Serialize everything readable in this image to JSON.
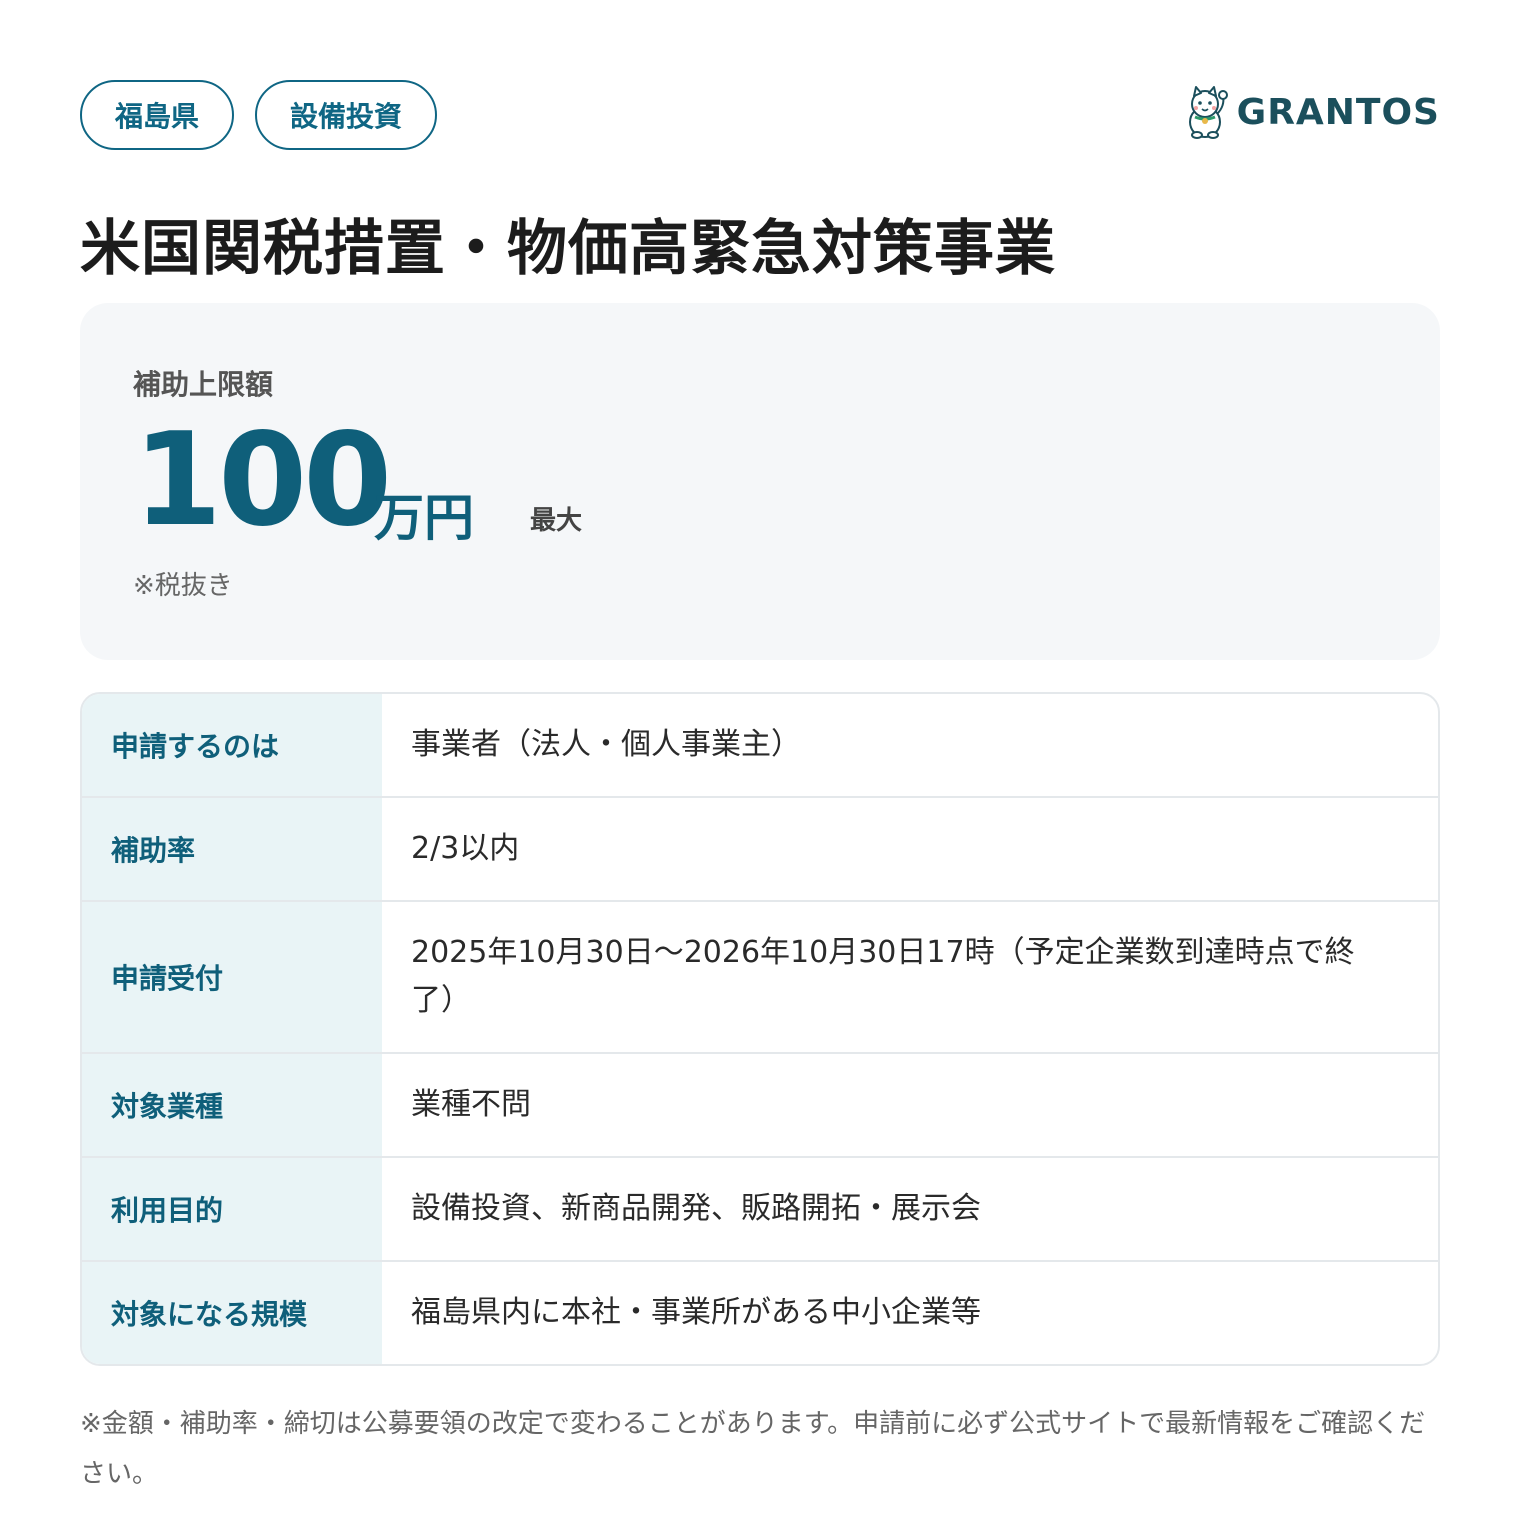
{
  "tags": [
    "福島県",
    "設備投資"
  ],
  "brand": {
    "name": "GRANTOS",
    "logo_icon": "lucky-cat-icon",
    "color": "#1b4f5c"
  },
  "title": "米国関税措置・物価高緊急対策事業",
  "amount": {
    "label": "補助上限額",
    "value": "100",
    "unit": "万円",
    "qualifier": "最大",
    "note": "※税抜き"
  },
  "details": [
    {
      "label": "申請するのは",
      "value": "事業者（法人・個人事業主）"
    },
    {
      "label": "補助率",
      "value": "2/3以内"
    },
    {
      "label": "申請受付",
      "value": "2025年10月30日〜2026年10月30日17時（予定企業数到達時点で終了）"
    },
    {
      "label": "対象業種",
      "value": "業種不問"
    },
    {
      "label": "利用目的",
      "value": "設備投資、新商品開発、販路開拓・展示会"
    },
    {
      "label": "対象になる規模",
      "value": "福島県内に本社・事業所がある中小企業等"
    }
  ],
  "footnote": "※金額・補助率・締切は公募要領の改定で変わることがあります。申請前に必ず公式サイトで最新情報をご確認ください。",
  "colors": {
    "accent": "#0f6684",
    "amount": "#0f5f7a",
    "header_bg": "#e9f4f6",
    "card_bg": "#f5f7f9",
    "border": "#e4e8eb"
  }
}
